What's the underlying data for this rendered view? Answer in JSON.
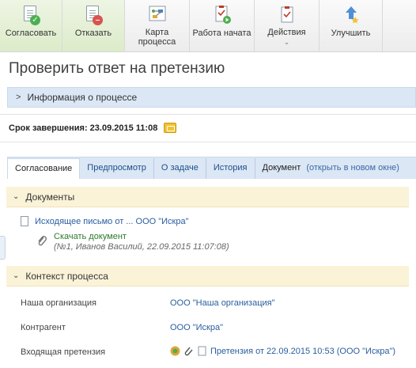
{
  "toolbar": {
    "approve": "Согласовать",
    "reject": "Отказать",
    "process_map": "Карта процесса",
    "work_started": "Работа начата",
    "actions": "Действия",
    "improve": "Улучшить",
    "colors": {
      "approve": "#4caf50",
      "reject": "#d9534f",
      "accent": "#f1c232"
    }
  },
  "page": {
    "title": "Проверить ответ на претензию"
  },
  "process_info": {
    "label": "Информация о процессе"
  },
  "deadline": {
    "label": "Срок завершения: 23.09.2015 11:08"
  },
  "tabs": {
    "items": [
      "Согласование",
      "Предпросмотр",
      "О задаче",
      "История",
      "Документ"
    ],
    "open_new": "(открыть в новом окне)"
  },
  "documents": {
    "header": "Документы",
    "doc_link": "Исходящее письмо от ... ООО \"Искра\"",
    "download": "Скачать документ",
    "download_meta": "(№1, Иванов Василий, 22.09.2015 11:07:08)"
  },
  "context": {
    "header": "Контекст процесса",
    "rows": [
      {
        "label": "Наша организация",
        "value": "ООО \"Наша организация\""
      },
      {
        "label": "Контрагент",
        "value": "ООО \"Искра\""
      },
      {
        "label": "Входящая претензия",
        "value": "Претензия от 22.09.2015 10:53 (ООО \"Искра\")"
      }
    ]
  }
}
